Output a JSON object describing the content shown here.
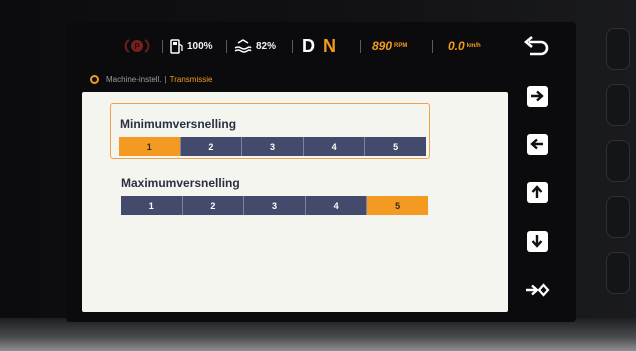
{
  "statusbar": {
    "fuel_value": "100%",
    "def_value": "82%",
    "gear_d": "D",
    "gear_n": "N",
    "rpm_value": "890",
    "rpm_unit": "RPM",
    "speed_value": "0.0",
    "speed_unit": "km/h"
  },
  "breadcrumb": {
    "parent": "Machine-instell.",
    "separator": "|",
    "current": "Transmissie"
  },
  "settings": [
    {
      "label": "Minimumversnelling",
      "options": [
        "1",
        "2",
        "3",
        "4",
        "5"
      ],
      "selected": "1"
    },
    {
      "label": "Maximumversnelling",
      "options": [
        "1",
        "2",
        "3",
        "4",
        "5"
      ],
      "selected": "5"
    }
  ],
  "colors": {
    "accent": "#f29a22",
    "segment": "#434a6b",
    "panel": "#f5f5f0",
    "display_bg": "#0b0b0d"
  },
  "icons": {
    "back": "back-arrow-icon",
    "right": "arrow-right-icon",
    "left": "arrow-left-icon",
    "up": "arrow-up-icon",
    "down": "arrow-down-icon",
    "enter": "enter-icon",
    "fuel": "fuel-icon",
    "def": "def-level-icon",
    "parking": "parking-brake-icon"
  }
}
